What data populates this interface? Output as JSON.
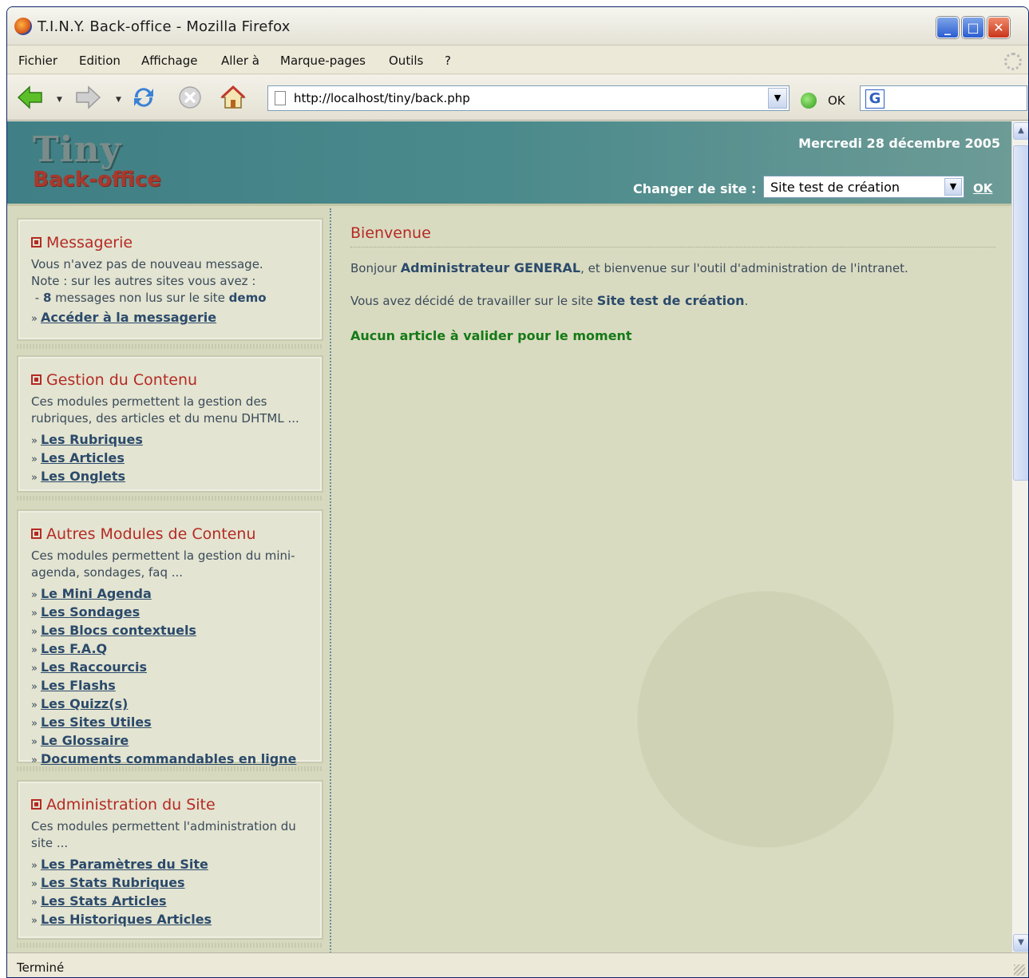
{
  "window": {
    "title": "T.I.N.Y. Back-office - Mozilla Firefox",
    "min_label": "_",
    "max_label": "□",
    "close_label": "✕"
  },
  "menu": [
    "Fichier",
    "Edition",
    "Affichage",
    "Aller à",
    "Marque-pages",
    "Outils",
    "?"
  ],
  "toolbar": {
    "url": "http://localhost/tiny/back.php",
    "go_label": "OK",
    "search_engine_letter": "G",
    "icons": [
      "back-icon",
      "forward-icon",
      "reload-icon",
      "stop-icon",
      "home-icon"
    ]
  },
  "banner": {
    "logo_line1": "Tiny",
    "logo_line2": "Back-office",
    "date": "Mercredi 28 décembre 2005",
    "site_label": "Changer de site :",
    "site_value": "Site test de création",
    "ok_label": "OK"
  },
  "sidebar": {
    "messagerie": {
      "title": "Messagerie",
      "line1": "Vous n'avez pas de nouveau message.",
      "line2": "Note : sur les autres sites vous avez :",
      "line3_prefix": " - ",
      "line3_count": "8",
      "line3_mid": " messages non lus sur le site ",
      "line3_site": "demo",
      "link": "Accéder à la messagerie"
    },
    "contenu": {
      "title": "Gestion du Contenu",
      "desc": "Ces modules permettent la gestion des rubriques, des articles et du menu DHTML ...",
      "links": [
        "Les Rubriques",
        "Les Articles",
        "Les Onglets"
      ]
    },
    "autres": {
      "title": "Autres Modules de Contenu",
      "desc": "Ces modules permettent la gestion du mini-agenda, sondages, faq ...",
      "links": [
        "Le Mini Agenda",
        "Les Sondages",
        "Les Blocs contextuels",
        "Les F.A.Q",
        "Les Raccourcis",
        "Les Flashs",
        "Les Quizz(s)",
        "Les Sites Utiles",
        "Le Glossaire",
        "Documents commandables en ligne"
      ]
    },
    "admin": {
      "title": "Administration du Site",
      "desc": "Ces modules permettent l'administration du site ...",
      "links": [
        "Les Paramètres du Site",
        "Les Stats Rubriques",
        "Les Stats Articles",
        "Les Historiques Articles"
      ]
    }
  },
  "main": {
    "heading": "Bienvenue",
    "greeting_prefix": "Bonjour ",
    "greeting_user": "Administrateur GENERAL",
    "greeting_suffix": ", et bienvenue sur l'outil d'administration de l'intranet.",
    "site_prefix": "Vous avez décidé de travailler sur le site ",
    "site_name": "Site test de création",
    "site_suffix": ".",
    "notice": "Aucun article à valider pour le moment"
  },
  "status": {
    "text": "Terminé"
  }
}
